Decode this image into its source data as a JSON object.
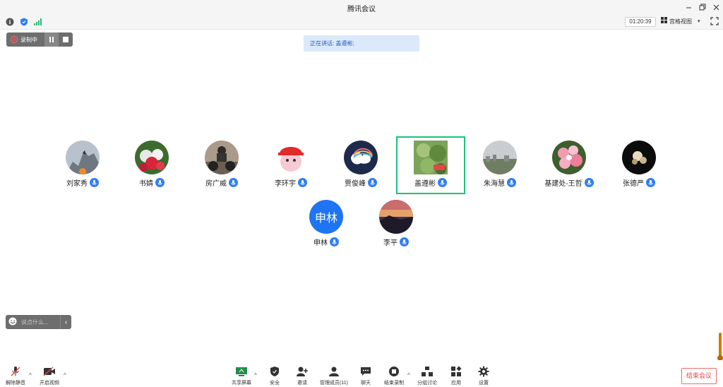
{
  "window": {
    "title": "腾讯会议"
  },
  "status": {
    "timer": "01:20:39",
    "view_label": "宫格视图"
  },
  "recording": {
    "label": "录制中"
  },
  "speaking": {
    "text": "正在讲话: 盖遵彬;"
  },
  "participants": [
    {
      "name": "刘家秀"
    },
    {
      "name": "书婧"
    },
    {
      "name": "房广威"
    },
    {
      "name": "李环宇"
    },
    {
      "name": "贾俊峰"
    },
    {
      "name": "盖遵彬"
    },
    {
      "name": "朱海慧"
    },
    {
      "name": "基建处-王哲"
    },
    {
      "name": "张德严"
    },
    {
      "name": "申林",
      "avatar_text": "申林"
    },
    {
      "name": "李平"
    }
  ],
  "chat": {
    "placeholder": "说点什么..."
  },
  "toolbar": {
    "unmute": "解除静音",
    "video": "开启视频",
    "share": "共享屏幕",
    "security": "安全",
    "invite": "邀请",
    "manage": "管理成员(11)",
    "chat": "聊天",
    "stop_record": "结束录制",
    "breakout": "分组讨论",
    "apps": "应用",
    "settings": "设置",
    "end_meeting": "结束会议"
  },
  "colors": {
    "accent": "#2f7ef5",
    "active_speaker": "#19c27a",
    "end_button": "#e04848",
    "banner_bg": "#dbe9fb"
  },
  "icons": [
    "info-icon",
    "shield-icon",
    "signal-icon",
    "minimize-icon",
    "restore-icon",
    "close-icon",
    "grid-icon",
    "fullscreen-icon",
    "mic-muted-icon",
    "video-off-icon",
    "share-screen-icon",
    "security-icon",
    "invite-icon",
    "members-icon",
    "chat-icon",
    "stop-record-icon",
    "breakout-icon",
    "apps-icon",
    "settings-icon"
  ]
}
